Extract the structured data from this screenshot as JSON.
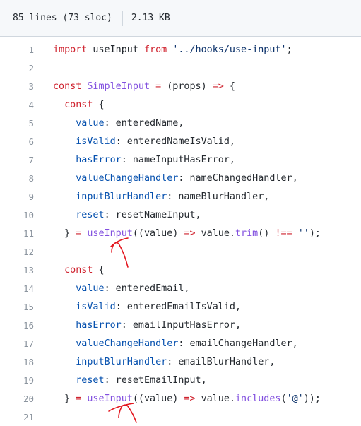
{
  "file_header": {
    "lines_info": "85 lines (73 sloc)",
    "size": "2.13 KB"
  },
  "code_lines": [
    {
      "n": "1",
      "tokens": [
        [
          "k",
          "import"
        ],
        [
          "t",
          " useInput "
        ],
        [
          "k",
          "from"
        ],
        [
          "t",
          " "
        ],
        [
          "s",
          "'../hooks/use-input'"
        ],
        [
          "t",
          ";"
        ]
      ]
    },
    {
      "n": "2",
      "tokens": []
    },
    {
      "n": "3",
      "tokens": [
        [
          "k",
          "const"
        ],
        [
          "t",
          " "
        ],
        [
          "f",
          "SimpleInput"
        ],
        [
          "t",
          " "
        ],
        [
          "k",
          "="
        ],
        [
          "t",
          " (props) "
        ],
        [
          "k",
          "=>"
        ],
        [
          "t",
          " {"
        ]
      ]
    },
    {
      "n": "4",
      "tokens": [
        [
          "t",
          "  "
        ],
        [
          "k",
          "const"
        ],
        [
          "t",
          " {"
        ]
      ]
    },
    {
      "n": "5",
      "tokens": [
        [
          "t",
          "    "
        ],
        [
          "p",
          "value"
        ],
        [
          "t",
          ": enteredName,"
        ]
      ]
    },
    {
      "n": "6",
      "tokens": [
        [
          "t",
          "    "
        ],
        [
          "p",
          "isValid"
        ],
        [
          "t",
          ": enteredNameIsValid,"
        ]
      ]
    },
    {
      "n": "7",
      "tokens": [
        [
          "t",
          "    "
        ],
        [
          "p",
          "hasError"
        ],
        [
          "t",
          ": nameInputHasError,"
        ]
      ]
    },
    {
      "n": "8",
      "tokens": [
        [
          "t",
          "    "
        ],
        [
          "p",
          "valueChangeHandler"
        ],
        [
          "t",
          ": nameChangedHandler,"
        ]
      ]
    },
    {
      "n": "9",
      "tokens": [
        [
          "t",
          "    "
        ],
        [
          "p",
          "inputBlurHandler"
        ],
        [
          "t",
          ": nameBlurHandler,"
        ]
      ]
    },
    {
      "n": "10",
      "tokens": [
        [
          "t",
          "    "
        ],
        [
          "p",
          "reset"
        ],
        [
          "t",
          ": resetNameInput,"
        ]
      ]
    },
    {
      "n": "11",
      "tokens": [
        [
          "t",
          "  } "
        ],
        [
          "k",
          "="
        ],
        [
          "t",
          " "
        ],
        [
          "f",
          "useInput"
        ],
        [
          "t",
          "((value) "
        ],
        [
          "k",
          "=>"
        ],
        [
          "t",
          " value."
        ],
        [
          "f",
          "trim"
        ],
        [
          "t",
          "() "
        ],
        [
          "k",
          "!=="
        ],
        [
          "t",
          " "
        ],
        [
          "s",
          "''"
        ],
        [
          "t",
          ");"
        ]
      ]
    },
    {
      "n": "12",
      "tokens": []
    },
    {
      "n": "13",
      "tokens": [
        [
          "t",
          "  "
        ],
        [
          "k",
          "const"
        ],
        [
          "t",
          " {"
        ]
      ]
    },
    {
      "n": "14",
      "tokens": [
        [
          "t",
          "    "
        ],
        [
          "p",
          "value"
        ],
        [
          "t",
          ": enteredEmail,"
        ]
      ]
    },
    {
      "n": "15",
      "tokens": [
        [
          "t",
          "    "
        ],
        [
          "p",
          "isValid"
        ],
        [
          "t",
          ": enteredEmailIsValid,"
        ]
      ]
    },
    {
      "n": "16",
      "tokens": [
        [
          "t",
          "    "
        ],
        [
          "p",
          "hasError"
        ],
        [
          "t",
          ": emailInputHasError,"
        ]
      ]
    },
    {
      "n": "17",
      "tokens": [
        [
          "t",
          "    "
        ],
        [
          "p",
          "valueChangeHandler"
        ],
        [
          "t",
          ": emailChangeHandler,"
        ]
      ]
    },
    {
      "n": "18",
      "tokens": [
        [
          "t",
          "    "
        ],
        [
          "p",
          "inputBlurHandler"
        ],
        [
          "t",
          ": emailBlurHandler,"
        ]
      ]
    },
    {
      "n": "19",
      "tokens": [
        [
          "t",
          "    "
        ],
        [
          "p",
          "reset"
        ],
        [
          "t",
          ": resetEmailInput,"
        ]
      ]
    },
    {
      "n": "20",
      "tokens": [
        [
          "t",
          "  } "
        ],
        [
          "k",
          "="
        ],
        [
          "t",
          " "
        ],
        [
          "f",
          "useInput"
        ],
        [
          "t",
          "((value) "
        ],
        [
          "k",
          "=>"
        ],
        [
          "t",
          " value."
        ],
        [
          "f",
          "includes"
        ],
        [
          "t",
          "("
        ],
        [
          "s",
          "'@'"
        ],
        [
          "t",
          "));"
        ]
      ]
    },
    {
      "n": "21",
      "tokens": []
    }
  ],
  "colors": {
    "keyword": "#cf222e",
    "function": "#8250df",
    "property": "#0550ae",
    "string": "#0a3069",
    "annotation": "#e3161e"
  },
  "annotations": [
    "red-hand-drawn-arrow-line-11",
    "red-hand-drawn-arrow-line-20"
  ]
}
